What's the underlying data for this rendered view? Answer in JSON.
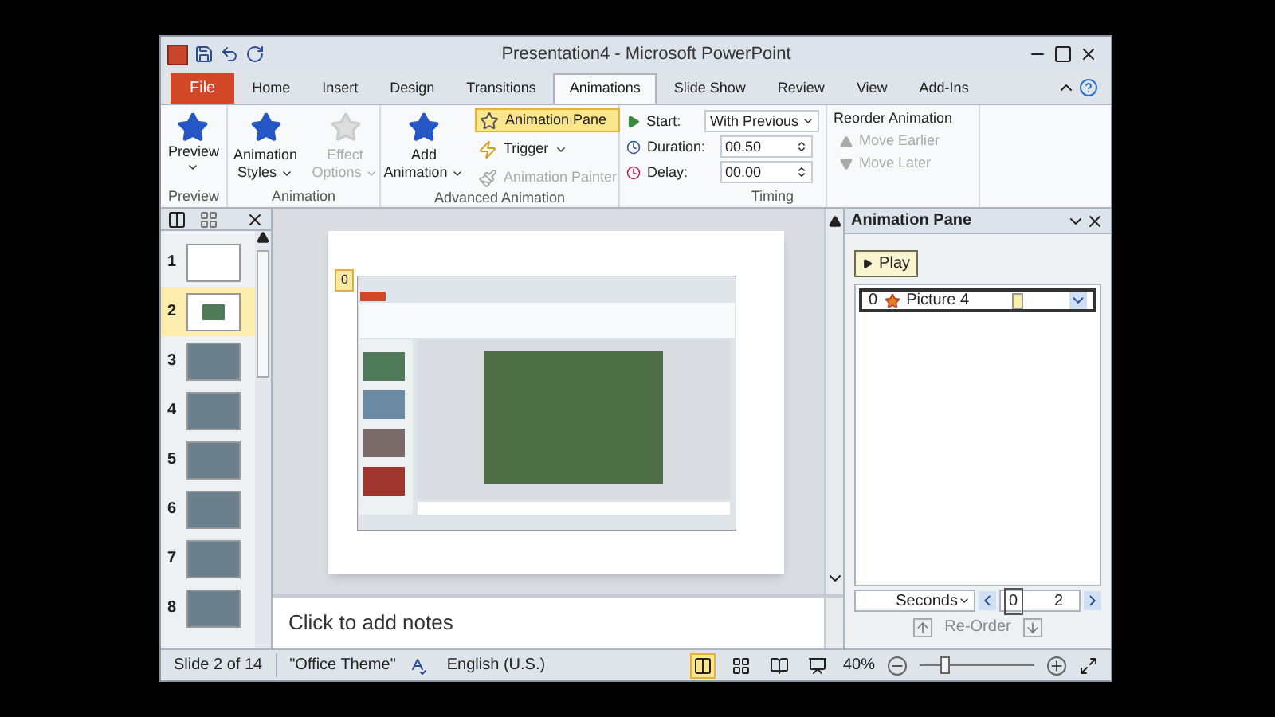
{
  "window": {
    "title": "Presentation4 - Microsoft PowerPoint"
  },
  "tabs": [
    {
      "label": "File",
      "kind": "file",
      "selected": false
    },
    {
      "label": "Home",
      "kind": "tab",
      "selected": false
    },
    {
      "label": "Insert",
      "kind": "tab",
      "selected": false
    },
    {
      "label": "Design",
      "kind": "tab",
      "selected": false
    },
    {
      "label": "Transitions",
      "kind": "tab",
      "selected": false
    },
    {
      "label": "Animations",
      "kind": "tab",
      "selected": true
    },
    {
      "label": "Slide Show",
      "kind": "tab",
      "selected": false
    },
    {
      "label": "Review",
      "kind": "tab",
      "selected": false
    },
    {
      "label": "View",
      "kind": "tab",
      "selected": false
    },
    {
      "label": "Add-Ins",
      "kind": "tab",
      "selected": false
    }
  ],
  "ribbon": {
    "preview": {
      "button": "Preview",
      "group": "Preview"
    },
    "animation": {
      "styles": "Animation Styles",
      "effect_options": {
        "label": "Effect Options",
        "disabled": true
      },
      "group": "Animation"
    },
    "advanced": {
      "add": "Add Animation",
      "pane": {
        "label": "Animation Pane",
        "on": true
      },
      "trigger": "Trigger",
      "painter": {
        "label": "Animation Painter",
        "disabled": true
      },
      "group": "Advanced Animation"
    },
    "timing": {
      "start_label": "Start:",
      "start_value": "With Previous",
      "duration_label": "Duration:",
      "duration_value": "00.50",
      "delay_label": "Delay:",
      "delay_value": "00.00",
      "group": "Timing"
    },
    "reorder": {
      "title": "Reorder Animation",
      "earlier": {
        "label": "Move Earlier",
        "disabled": true
      },
      "later": {
        "label": "Move Later",
        "disabled": true
      }
    }
  },
  "slides": [
    {
      "number": "1",
      "kind": "title",
      "selected": false
    },
    {
      "number": "2",
      "kind": "screenshot",
      "selected": true
    },
    {
      "number": "3",
      "kind": "photo",
      "selected": false
    },
    {
      "number": "4",
      "kind": "photo",
      "selected": false
    },
    {
      "number": "5",
      "kind": "photo",
      "selected": false
    },
    {
      "number": "6",
      "kind": "photo",
      "selected": false
    },
    {
      "number": "7",
      "kind": "photo",
      "selected": false
    },
    {
      "number": "8",
      "kind": "photo",
      "selected": false
    }
  ],
  "slide": {
    "animation_badge": "0"
  },
  "notes": {
    "placeholder": "Click to add notes"
  },
  "animation_pane": {
    "title": "Animation Pane",
    "play": "Play",
    "items": [
      {
        "index": "0",
        "name": "Picture 4",
        "selected": true
      }
    ],
    "timeline": {
      "unit": "Seconds",
      "ticks": [
        "0",
        "2"
      ]
    },
    "reorder": "Re-Order"
  },
  "status_bar": {
    "slide": "Slide 2 of 14",
    "theme": "\"Office Theme\"",
    "language": "English (U.S.)",
    "zoom": "40%",
    "zoom_level": {
      "level": 0.2
    },
    "views": [
      {
        "kind": "normal",
        "selected": true
      },
      {
        "kind": "sorter",
        "selected": false
      },
      {
        "kind": "reading",
        "selected": false
      },
      {
        "kind": "slideshow",
        "selected": false
      }
    ]
  }
}
